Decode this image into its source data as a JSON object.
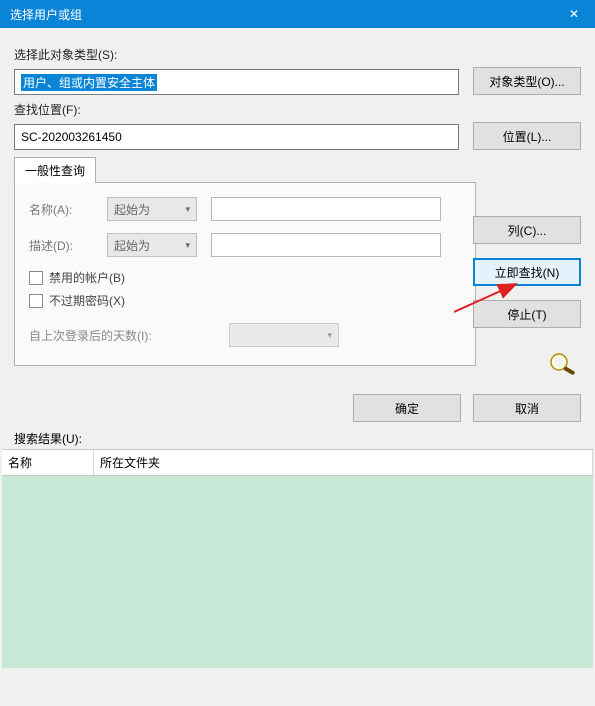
{
  "title": "选择用户或组",
  "labels": {
    "objectType": "选择此对象类型(S):",
    "searchLocation": "查找位置(F):",
    "searchResults": "搜索结果(U):"
  },
  "fields": {
    "objectType": "用户、组或内置安全主体",
    "location": "SC-202003261450"
  },
  "buttons": {
    "objectTypes": "对象类型(O)...",
    "locations": "位置(L)...",
    "columns": "列(C)...",
    "findNow": "立即查找(N)",
    "stop": "停止(T)",
    "ok": "确定",
    "cancel": "取消"
  },
  "tab": {
    "general": "一般性查询",
    "name": "名称(A):",
    "description": "描述(D):",
    "startsWith": "起始为",
    "disabledAccounts": "禁用的帐户(B)",
    "nonExpiringPw": "不过期密码(X)",
    "daysSinceLogon": "自上次登录后的天数(I):"
  },
  "grid": {
    "col1": "名称",
    "col2": "所在文件夹"
  }
}
